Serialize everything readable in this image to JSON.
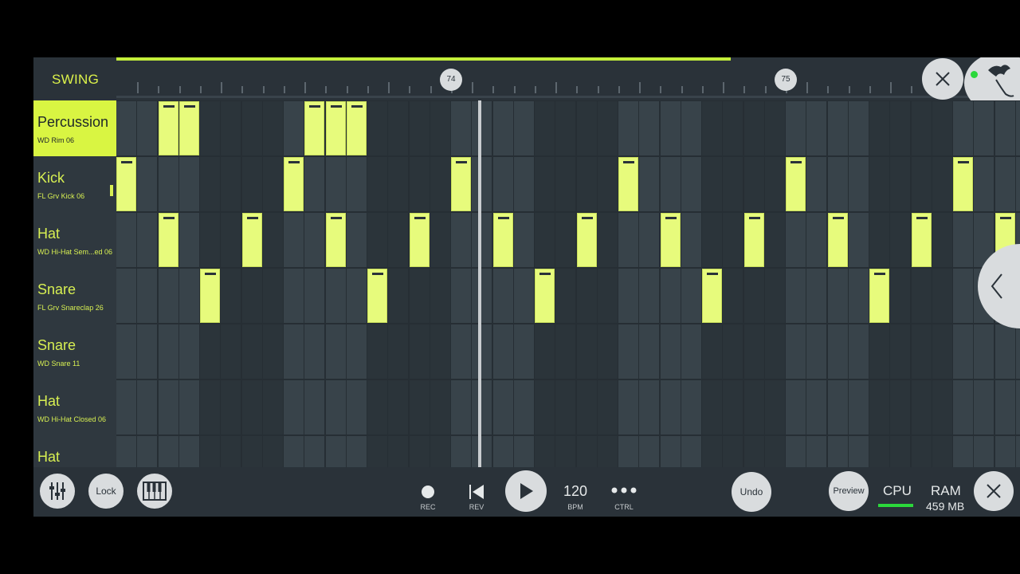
{
  "header": {
    "swing_label": "SWING",
    "swing_amount": 0.68,
    "bar_markers": [
      "74",
      "75"
    ]
  },
  "channels": [
    {
      "name": "Percussion",
      "sample": "WD Rim 06",
      "selected": true
    },
    {
      "name": "Kick",
      "sample": "FL Grv Kick 06",
      "selected": false
    },
    {
      "name": "Hat",
      "sample": "WD Hi-Hat Sem...ed 06",
      "selected": false
    },
    {
      "name": "Snare",
      "sample": "FL Grv Snareclap 26",
      "selected": false
    },
    {
      "name": "Snare",
      "sample": "WD Snare 11",
      "selected": false
    },
    {
      "name": "Hat",
      "sample": "WD Hi-Hat Closed 06",
      "selected": false
    },
    {
      "name": "Hat",
      "sample": "",
      "selected": false
    }
  ],
  "pattern": {
    "steps": [
      [
        2,
        3,
        9,
        10,
        11
      ],
      [
        0,
        8,
        16,
        24,
        32,
        40
      ],
      [
        2,
        6,
        10,
        14,
        18,
        22,
        26,
        30,
        34,
        38,
        42
      ],
      [
        4,
        12,
        20,
        28,
        36
      ],
      [],
      [],
      []
    ]
  },
  "transport": {
    "rec_label": "REC",
    "rev_label": "REV",
    "bpm_value": "120",
    "bpm_label": "BPM",
    "ctrl_label": "CTRL",
    "undo_label": "Undo",
    "preview_label": "Preview",
    "lock_label": "Lock",
    "cpu_label": "CPU",
    "ram_label": "RAM",
    "ram_value": "459 MB"
  },
  "colors": {
    "accent": "#d9f542",
    "note": "#e7fb7c",
    "background": "#2a3239",
    "cpu_meter": "#2bd83b"
  }
}
